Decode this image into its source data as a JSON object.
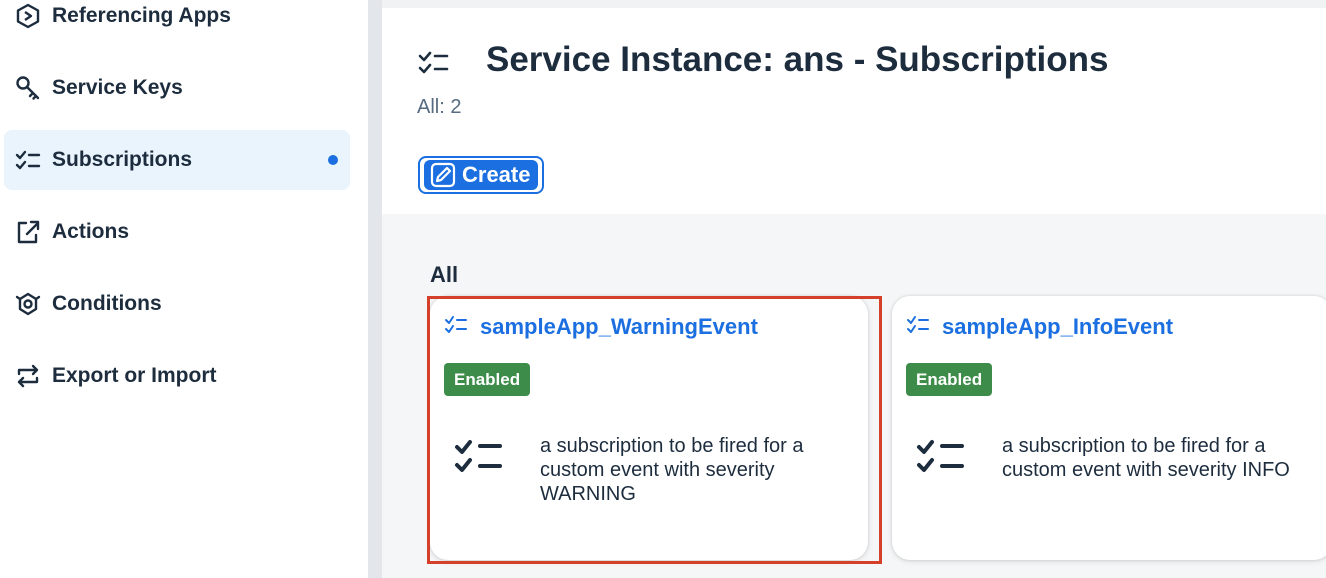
{
  "sidebar": {
    "items": [
      {
        "label": "Referencing Apps",
        "icon": "referencing-apps-icon"
      },
      {
        "label": "Service Keys",
        "icon": "key-icon"
      },
      {
        "label": "Subscriptions",
        "icon": "checklist-icon",
        "active": true
      },
      {
        "label": "Actions",
        "icon": "share-icon"
      },
      {
        "label": "Conditions",
        "icon": "conditions-icon"
      },
      {
        "label": "Export or Import",
        "icon": "sync-icon"
      }
    ]
  },
  "header": {
    "title": "Service Instance: ans - Subscriptions",
    "count": "All: 2",
    "create_label": "Create"
  },
  "section": {
    "label": "All"
  },
  "cards": [
    {
      "title": "sampleApp_WarningEvent",
      "status": "Enabled",
      "description": "a subscription to be fired for a custom event with severity WARNING"
    },
    {
      "title": "sampleApp_InfoEvent",
      "status": "Enabled",
      "description": "a subscription to be fired for a custom event with severity INFO"
    }
  ],
  "colors": {
    "accent": "#1b6fe0",
    "enabled_badge": "#3d8c4a",
    "highlight": "#d5402b",
    "active_bg": "#eaf4fd"
  }
}
